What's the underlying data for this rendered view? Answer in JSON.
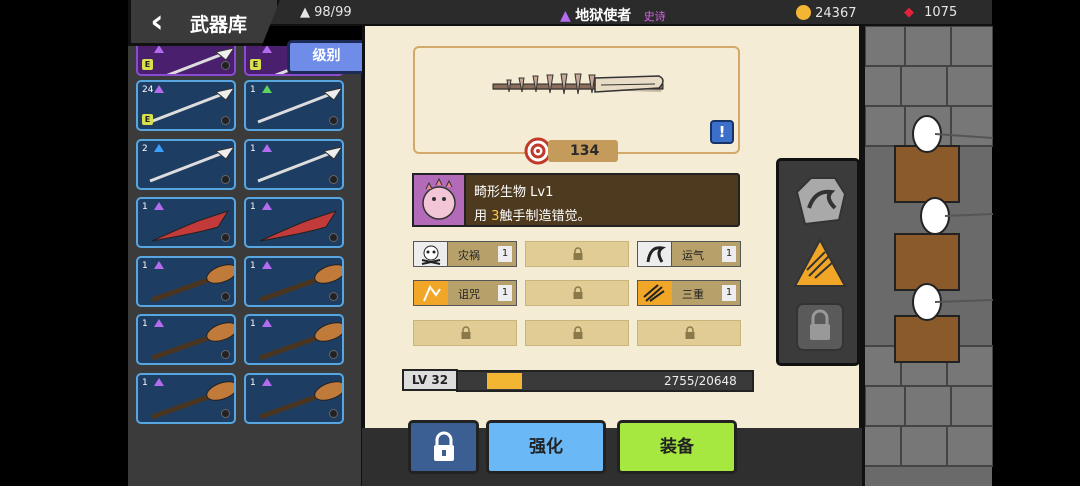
{
  "header": {
    "title": "武器库",
    "capacity": "98/99",
    "weapon_name": "地狱使者",
    "rarity": "史诗",
    "gold": "24367",
    "gems": "1075"
  },
  "sort_button": "级别",
  "inventory": [
    {
      "count": "",
      "rarity": "purple",
      "badge": "E"
    },
    {
      "count": "",
      "rarity": "purple",
      "badge": "E"
    },
    {
      "count": "24",
      "rarity": "purple",
      "badge": "E"
    },
    {
      "count": "1",
      "rarity": "green",
      "badge": ""
    },
    {
      "count": "2",
      "rarity": "blue",
      "badge": ""
    },
    {
      "count": "1",
      "rarity": "purple",
      "badge": ""
    },
    {
      "count": "1",
      "rarity": "purple",
      "badge": ""
    },
    {
      "count": "1",
      "rarity": "purple",
      "badge": ""
    },
    {
      "count": "1",
      "rarity": "purple",
      "badge": ""
    },
    {
      "count": "1",
      "rarity": "purple",
      "badge": ""
    },
    {
      "count": "1",
      "rarity": "purple",
      "badge": ""
    },
    {
      "count": "1",
      "rarity": "purple",
      "badge": ""
    },
    {
      "count": "1",
      "rarity": "purple",
      "badge": ""
    },
    {
      "count": "1",
      "rarity": "purple",
      "badge": ""
    }
  ],
  "weapon": {
    "power": "134",
    "skill_name": "畸形生物 Lv1",
    "skill_desc_pre": "用",
    "skill_desc_num": "3",
    "skill_desc_post": "触手制造错觉。"
  },
  "traits": [
    {
      "name": "灾祸",
      "level": "1",
      "icon": "skull-icon"
    },
    {
      "name": "",
      "locked": true
    },
    {
      "name": "运气",
      "level": "1",
      "icon": "horseshoe-icon"
    },
    {
      "name": "诅咒",
      "level": "1",
      "icon": "curse-icon"
    },
    {
      "name": "",
      "locked": true
    },
    {
      "name": "三重",
      "level": "1",
      "icon": "triple-arrow-icon"
    },
    {
      "name": "",
      "locked": true
    },
    {
      "name": "",
      "locked": true
    },
    {
      "name": "",
      "locked": true
    }
  ],
  "level": {
    "label": "LV 32",
    "xp_text": "2755/20648",
    "progress": 0.1334
  },
  "buttons": {
    "upgrade": "强化",
    "equip": "装备"
  }
}
